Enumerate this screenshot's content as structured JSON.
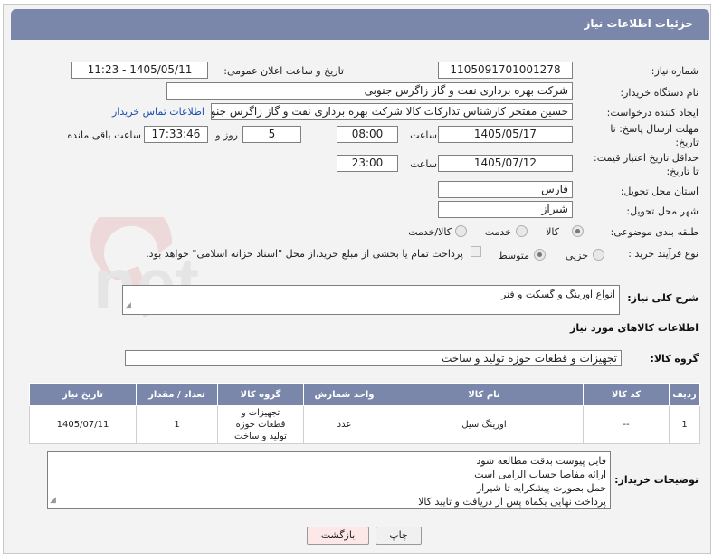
{
  "header": {
    "title": "جزئیات اطلاعات نیاز"
  },
  "fields": {
    "need_number_label": "شماره نیاز:",
    "need_number": "1105091701001278",
    "announce_label": "تاریخ و ساعت اعلان عمومی:",
    "announce_value": "1405/05/11 - 11:23",
    "buyer_org_label": "نام دستگاه خریدار:",
    "buyer_org": "شرکت بهره برداری نفت و گاز زاگرس جنوبی",
    "creator_label": "ایجاد کننده درخواست:",
    "creator": "حسین مفتخر کارشناس تدارکات کالا شرکت بهره برداری نفت و گاز زاگرس جنوبی",
    "contact_link": "اطلاعات تماس خریدار",
    "reply_deadline_label_1": "مهلت ارسال پاسخ: تا",
    "reply_deadline_label_2": "تاریخ:",
    "reply_date": "1405/05/17",
    "time_label": "ساعت",
    "reply_time": "08:00",
    "days_value": "5",
    "days_label": "روز و",
    "remaining_time": "17:33:46",
    "remaining_label": "ساعت باقی مانده",
    "price_validity_label_1": "حداقل تاریخ اعتبار قیمت:",
    "price_validity_label_2": "تا تاریخ:",
    "price_date": "1405/07/12",
    "price_time": "23:00",
    "province_label": "استان محل تحویل:",
    "province": "فارس",
    "city_label": "شهر محل تحویل:",
    "city": "شیراز",
    "category_label": "طبقه بندی موضوعی:",
    "category_options": [
      "کالا",
      "خدمت",
      "کالا/خدمت"
    ],
    "process_label": "نوع فرآیند خرید :",
    "process_options": [
      "جزیی",
      "متوسط"
    ],
    "payment_note": "پرداخت تمام یا بخشی از مبلغ خرید،از محل \"اسناد خزانه اسلامی\" خواهد بود."
  },
  "description": {
    "label": "شرح کلی نیاز:",
    "value": "انواع اورینگ و گسکت و فنر"
  },
  "goods_info": {
    "title": "اطلاعات کالاهای مورد نیاز",
    "group_label": "گروه کالا:",
    "group_value": "تجهیزات و قطعات حوزه تولید و ساخت"
  },
  "table": {
    "headers": [
      "ردیف",
      "کد کالا",
      "نام کالا",
      "واحد شمارش",
      "گروه کالا",
      "تعداد / مقدار",
      "تاریخ نیاز"
    ],
    "rows": [
      [
        "1",
        "--",
        "اورینگ سیل",
        "عدد",
        "تجهیزات و قطعات حوزه تولید و ساخت",
        "1",
        "1405/07/11"
      ]
    ]
  },
  "buyer_notes": {
    "label": "توضیحات خریدار:",
    "lines": [
      "فایل پیوست بدقت مطالعه شود",
      "ارائه مفاصا حساب الزامی است",
      "حمل بصورت پیشکرایه تا شیراز",
      "پرداخت نهایی یکماه پس از دریافت و تایید کالا"
    ]
  },
  "buttons": {
    "print": "چاپ",
    "back": "بازگشت"
  },
  "watermark": {
    "text": "AriaTender.net"
  },
  "colors": {
    "header": "#7a86aa",
    "link": "#1a4fb0",
    "back_button": "#fde8e8"
  }
}
